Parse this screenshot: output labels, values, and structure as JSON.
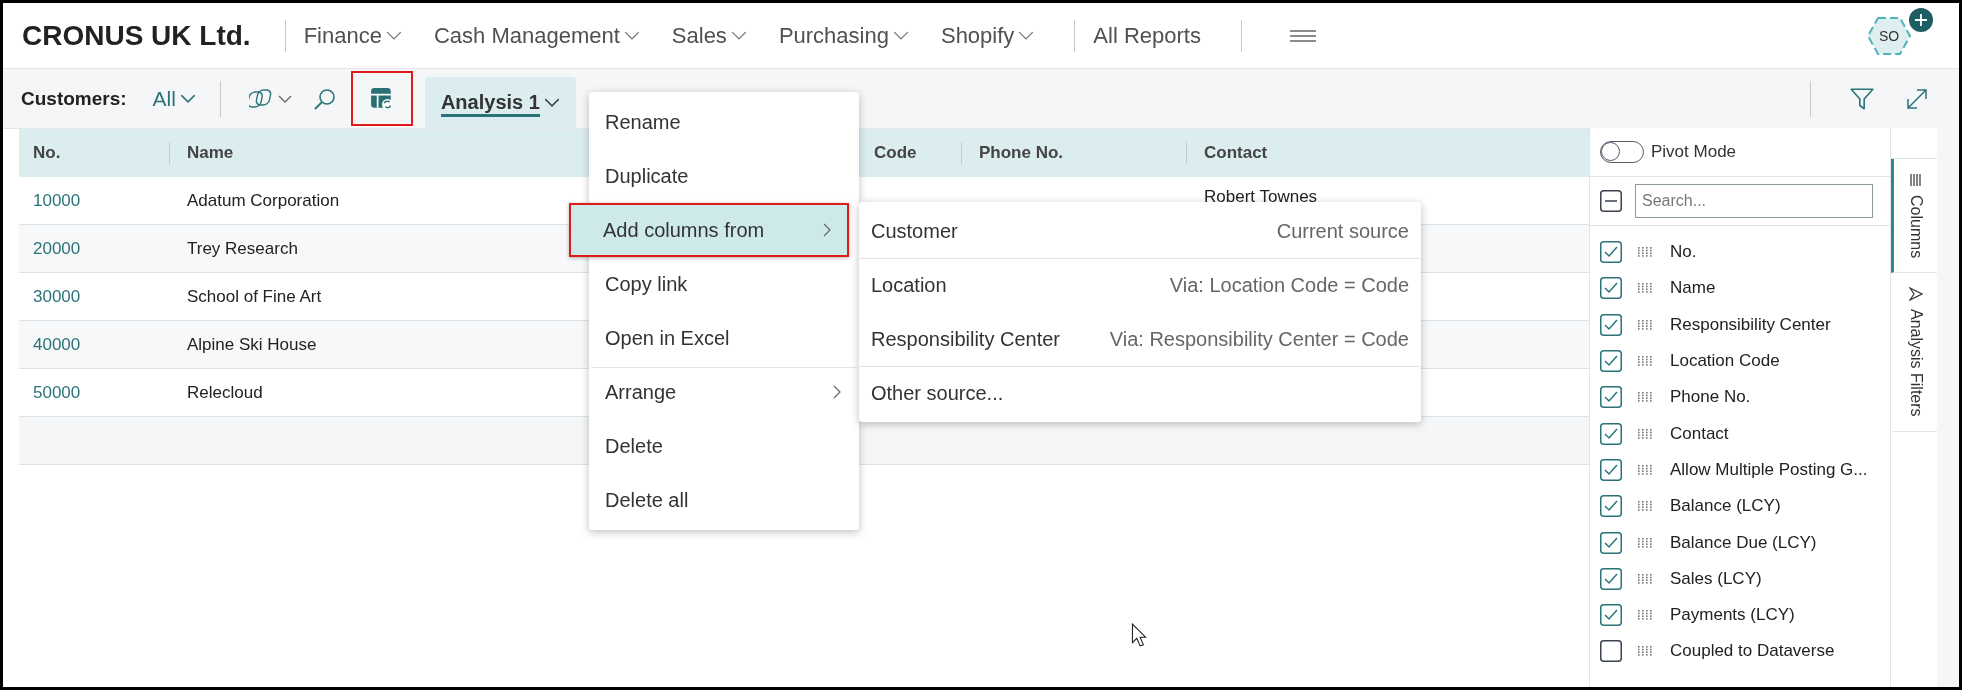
{
  "app": {
    "company": "CRONUS UK Ltd.",
    "avatar": "SO"
  },
  "nav": [
    {
      "label": "Finance",
      "dropdown": true
    },
    {
      "label": "Cash Management",
      "dropdown": true
    },
    {
      "label": "Sales",
      "dropdown": true
    },
    {
      "label": "Purchasing",
      "dropdown": true
    },
    {
      "label": "Shopify",
      "dropdown": true
    },
    {
      "label": "All Reports",
      "dropdown": false
    }
  ],
  "toolbar": {
    "title": "Customers:",
    "view": "All",
    "analysis_button": {
      "highlighted": true
    },
    "analysis_tab": {
      "label": "Analysis 1",
      "selected": true
    }
  },
  "table": {
    "columns": [
      "No.",
      "Name",
      "Code",
      "Phone No.",
      "Contact"
    ],
    "rows": [
      {
        "no": "10000",
        "name": "Adatum Corporation",
        "contact": "Robert Townes"
      },
      {
        "no": "20000",
        "name": "Trey Research"
      },
      {
        "no": "30000",
        "name": "School of Fine Art"
      },
      {
        "no": "40000",
        "name": "Alpine Ski House"
      },
      {
        "no": "50000",
        "name": "Relecloud"
      }
    ]
  },
  "context_menu": {
    "items": [
      {
        "label": "Rename",
        "submenu": false,
        "selected": false,
        "highlighted": false,
        "divider_before": false
      },
      {
        "label": "Duplicate",
        "submenu": false,
        "selected": false,
        "highlighted": false,
        "divider_before": false
      },
      {
        "label": "Add columns from",
        "submenu": true,
        "selected": true,
        "highlighted": true,
        "divider_before": false
      },
      {
        "label": "Copy link",
        "submenu": false,
        "selected": false,
        "highlighted": false,
        "divider_before": false
      },
      {
        "label": "Open in Excel",
        "submenu": false,
        "selected": false,
        "highlighted": false,
        "divider_before": false
      },
      {
        "label": "Arrange",
        "submenu": true,
        "selected": false,
        "highlighted": false,
        "divider_before": true
      },
      {
        "label": "Delete",
        "submenu": false,
        "selected": false,
        "highlighted": false,
        "divider_before": false
      },
      {
        "label": "Delete all",
        "submenu": false,
        "selected": false,
        "highlighted": false,
        "divider_before": false
      }
    ]
  },
  "submenu": {
    "items": [
      {
        "label": "Customer",
        "detail": "Current source",
        "divider_before": false
      },
      {
        "label": "Location",
        "detail": "Via: Location Code = Code",
        "divider_before": true
      },
      {
        "label": "Responsibility Center",
        "detail": "Via: Responsibility Center = Code",
        "divider_before": false
      },
      {
        "label": "Other source...",
        "divider_before": true
      }
    ]
  },
  "columns_panel": {
    "pivot_mode": {
      "label": "Pivot Mode",
      "on": false
    },
    "select_all": {
      "indeterminate": true
    },
    "search": {
      "placeholder": "Search..."
    },
    "columns": [
      {
        "label": "No.",
        "checked": true
      },
      {
        "label": "Name",
        "checked": true
      },
      {
        "label": "Responsibility Center",
        "checked": true
      },
      {
        "label": "Location Code",
        "checked": true
      },
      {
        "label": "Phone No.",
        "checked": true
      },
      {
        "label": "Contact",
        "checked": true
      },
      {
        "label": "Allow Multiple Posting G...",
        "checked": true
      },
      {
        "label": "Balance (LCY)",
        "checked": true
      },
      {
        "label": "Balance Due (LCY)",
        "checked": true
      },
      {
        "label": "Sales (LCY)",
        "checked": true
      },
      {
        "label": "Payments (LCY)",
        "checked": true
      },
      {
        "label": "Coupled to Dataverse",
        "checked": false
      }
    ]
  },
  "side_tabs": [
    {
      "label": "Columns",
      "selected": true,
      "kind": "columns"
    },
    {
      "label": "Analysis Filters",
      "selected": false,
      "kind": "filters"
    }
  ]
}
